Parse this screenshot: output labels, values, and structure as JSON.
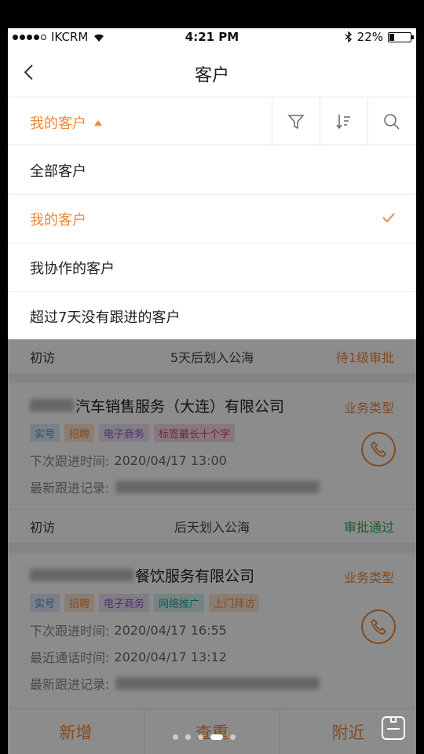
{
  "status_bar": {
    "carrier": "IKCRM",
    "time": "4:21 PM",
    "battery": "22%",
    "battery_level": 0.22
  },
  "header": {
    "title": "客户"
  },
  "filter": {
    "scope_label": "我的客户"
  },
  "dropdown": {
    "items": [
      {
        "label": "全部客户"
      },
      {
        "label": "我的客户",
        "selected": true
      },
      {
        "label": "我协作的客户"
      },
      {
        "label": "超过7天没有跟进的客户"
      }
    ]
  },
  "list": {
    "strip1": {
      "left": "初访",
      "mid": "5天后划入公海",
      "right": "待1级审批",
      "right_color": "#f0883a"
    },
    "card1": {
      "name_visible": "汽车销售服务（大连）有限公司",
      "business_type": "业务类型",
      "tags": [
        {
          "label": "实号",
          "color": "#4a90d9",
          "bg": "#dde9f7"
        },
        {
          "label": "招聘",
          "color": "#f0883a",
          "bg": "#fbe6d3"
        },
        {
          "label": "电子商务",
          "color": "#8a5cc4",
          "bg": "#ece2f6"
        },
        {
          "label": "标签最长十个字",
          "color": "#d63a7a",
          "bg": "#f8d9e6"
        }
      ],
      "next_followup_label": "下次跟进时间:",
      "next_followup_value": "2020/04/17  13:00",
      "latest_record_label": "最新跟进记录:"
    },
    "strip2": {
      "left": "初访",
      "mid": "后天划入公海",
      "right": "审批通过",
      "right_color": "#3aa55a"
    },
    "card2": {
      "name_visible": "餐饮服务有限公司",
      "business_type": "业务类型",
      "tags": [
        {
          "label": "实号",
          "color": "#4a90d9",
          "bg": "#dde9f7"
        },
        {
          "label": "招聘",
          "color": "#f0883a",
          "bg": "#fbe6d3"
        },
        {
          "label": "电子商务",
          "color": "#8a5cc4",
          "bg": "#ece2f6"
        },
        {
          "label": "网络推广",
          "color": "#2aa5a0",
          "bg": "#d6f0ef"
        },
        {
          "label": "上门拜访",
          "color": "#f0883a",
          "bg": "#fbe6d3"
        }
      ],
      "next_followup_label": "下次跟进时间:",
      "next_followup_value": "2020/04/17  16:55",
      "last_call_label": "最近通话时间:",
      "last_call_value": "2020/04/17  13:12",
      "latest_record_label": "最新跟进记录:"
    }
  },
  "bottom_bar": {
    "add": "新增",
    "dedupe": "查重",
    "nearby": "附近"
  },
  "colors": {
    "accent": "#f0883a"
  }
}
